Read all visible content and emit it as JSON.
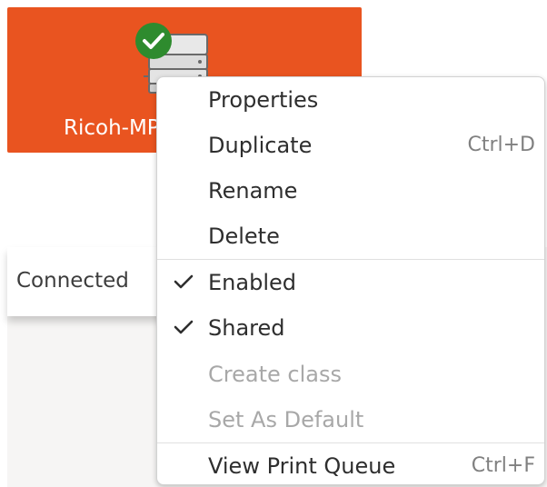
{
  "printer": {
    "name": "Ricoh-MP",
    "status_icon": "checkmark-badge-icon",
    "tile_color": "#e95420"
  },
  "status": {
    "text": "Connected"
  },
  "context_menu": {
    "items": [
      {
        "label": "Properties",
        "accel": ""
      },
      {
        "label": "Duplicate",
        "accel": "Ctrl+D"
      },
      {
        "label": "Rename",
        "accel": ""
      },
      {
        "label": "Delete",
        "accel": ""
      },
      {
        "label": "Enabled",
        "checked": true
      },
      {
        "label": "Shared",
        "checked": true
      },
      {
        "label": "Create class",
        "disabled": true
      },
      {
        "label": "Set As Default",
        "disabled": true
      },
      {
        "label": "View Print Queue",
        "accel": "Ctrl+F"
      }
    ]
  }
}
